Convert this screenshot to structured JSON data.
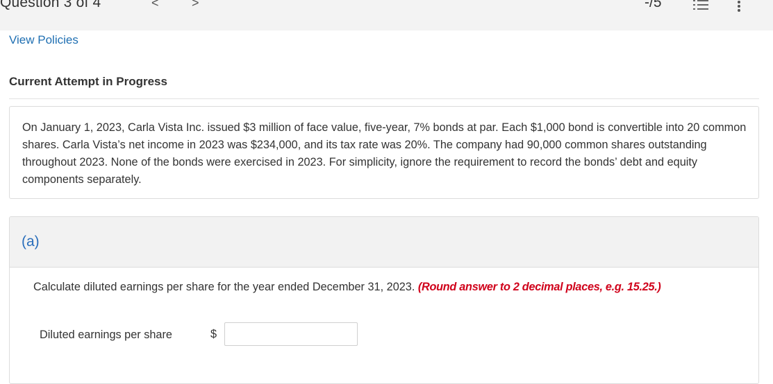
{
  "header": {
    "question_title": "Question 3 of 4",
    "prev_glyph": "<",
    "next_glyph": ">",
    "score": "-/5",
    "icons": [
      "list-icon",
      "more-vertical-icon"
    ]
  },
  "links": {
    "view_policies": "View Policies"
  },
  "status": {
    "attempt": "Current Attempt in Progress"
  },
  "problem": {
    "text": "On January 1, 2023, Carla Vista Inc. issued $3 million of face value, five-year, 7% bonds at par. Each $1,000 bond is convertible into 20 common shares. Carla Vista’s net income in 2023 was $234,000, and its tax rate was 20%. The company had 90,000 common shares outstanding throughout 2023. None of the bonds were exercised in 2023. For simplicity, ignore the requirement to record the bonds’ debt and equity components separately."
  },
  "part_a": {
    "label": "(a)",
    "instruction": "Calculate diluted earnings per share for the year ended December 31, 2023.",
    "round_note": "(Round answer to 2 decimal places, e.g. 15.25.)",
    "answer_label": "Diluted earnings per share",
    "currency": "$",
    "answer_value": ""
  },
  "colors": {
    "link": "#1f6fb2",
    "part_label": "#2a6ebb",
    "round_note": "#d0021b",
    "header_bg": "#f3f3f3"
  }
}
